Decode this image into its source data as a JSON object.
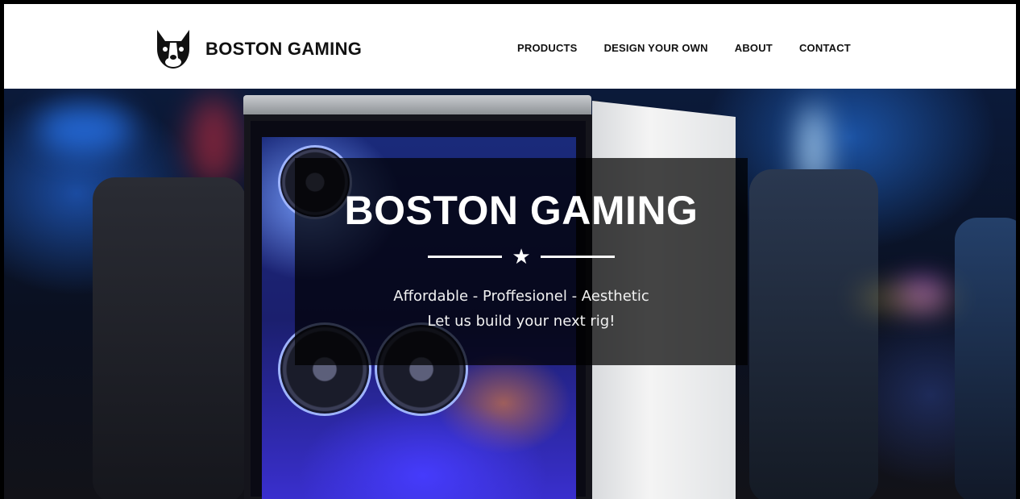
{
  "header": {
    "brand": "BOSTON GAMING",
    "logo_icon": "boston-terrier-logo-icon",
    "nav": [
      {
        "label": "PRODUCTS"
      },
      {
        "label": "DESIGN YOUR OWN"
      },
      {
        "label": "ABOUT"
      },
      {
        "label": "CONTACT"
      }
    ]
  },
  "hero": {
    "title": "BOSTON GAMING",
    "divider_icon": "star-icon",
    "tagline": "Affordable - Proffesionel - Aesthetic",
    "subline": "Let us build your next rig!"
  },
  "colors": {
    "nav_background": "#ffffff",
    "overlay": "#000000",
    "accent_blue": "#2f6bff"
  }
}
